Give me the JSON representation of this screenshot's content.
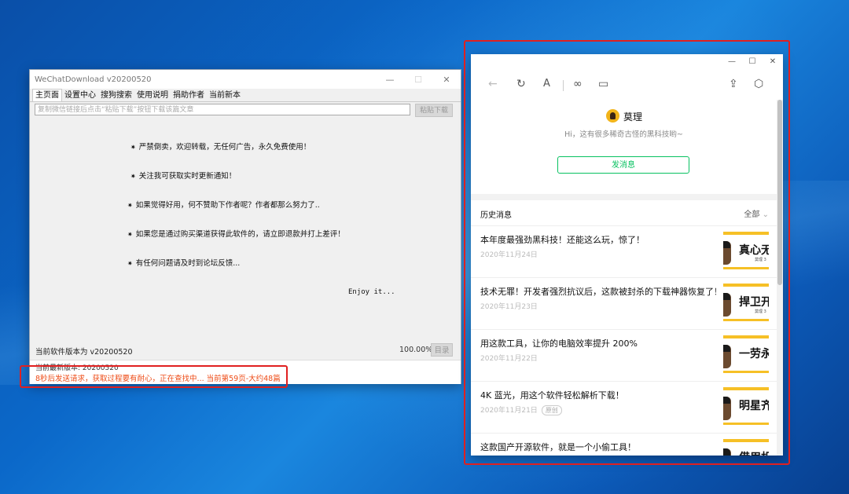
{
  "left_window": {
    "title": "WeChatDownload v20200520",
    "controls": [
      "—",
      "☐",
      "✕"
    ],
    "tabs": [
      "主页面",
      "设置中心",
      "搜狗搜索",
      "使用说明",
      "捐助作者",
      "当前新本"
    ],
    "url_placeholder": "复制微信链接后点击“粘贴下载”按钮下载该篇文章",
    "paste_button": "粘贴下载",
    "messages": [
      "严禁倒卖，欢迎转载，无任何广告，永久免费使用！",
      "关注我可获取实时更新通知！",
      "如果觉得好用，何不赞助下作者呢？作者都那么努力了..",
      "如果您是通过购买渠道获得此软件的，请立即退款并打上差评！",
      "有任何问题请及时到论坛反馈..."
    ],
    "enjoy": "Enjoy it...",
    "version_label": "当前软件版本为 v20200520",
    "progress": "100.00%",
    "dir_button": "目录",
    "latest_version": "当前最新版本: 20200520",
    "log_line": "8秒后发送请求，获取过程要有耐心，正在查找中... 当前第59页-大约48篇"
  },
  "right_window": {
    "controls": [
      "—",
      "☐",
      "✕"
    ],
    "toolbar_icons": [
      "back-icon",
      "refresh-icon",
      "font-icon",
      "link-icon",
      "window-icon",
      "share-icon",
      "cube-icon"
    ],
    "profile_name": "莫理",
    "profile_desc": "Hi，这有很多稀奇古怪的黑科技哟~",
    "send_button": "发消息",
    "history_title": "历史消息",
    "history_filter": "全部",
    "articles": [
      {
        "title": "本年度最强劲黑科技！还能这么玩，惊了！",
        "date": "2020年11月24日",
        "tag": "",
        "thumb": "真心无",
        "thumb_sub": "莫理  3"
      },
      {
        "title": "技术无罪！开发者强烈抗议后，这款被封杀的下载神器恢复了！",
        "date": "2020年11月23日",
        "tag": "",
        "thumb": "捍卫开",
        "thumb_sub": "莫理  3"
      },
      {
        "title": "用这款工具，让你的电脑效率提升 200%",
        "date": "2020年11月22日",
        "tag": "",
        "thumb": "一劳永",
        "thumb_sub": ""
      },
      {
        "title": "4K 蓝光，用这个软件轻松解析下载！",
        "date": "2020年11月21日",
        "tag": "原创",
        "thumb": "明星齐",
        "thumb_sub": ""
      },
      {
        "title": "这款国产开源软件，就是一个小偷工具！",
        "date": "",
        "tag": "",
        "thumb": "借用机",
        "thumb_sub": ""
      }
    ]
  },
  "colors": {
    "accent_green": "#07c160",
    "log_orange": "#ee4b16",
    "highlight_red": "#e02020",
    "thumb_yellow": "#f6c026"
  }
}
